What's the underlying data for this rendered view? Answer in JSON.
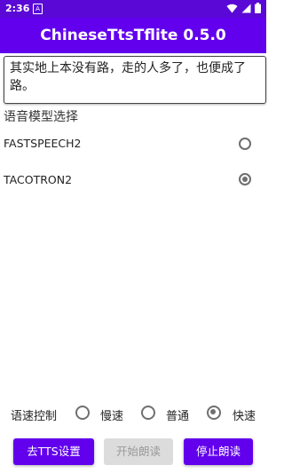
{
  "status_bar": {
    "time": "2:36",
    "icons": [
      "app-notification-icon",
      "wifi-icon",
      "signal-icon",
      "battery-icon"
    ]
  },
  "app_bar": {
    "title": "ChineseTtsTflite 0.5.0"
  },
  "text_input": {
    "value": "其实地上本没有路，走的人多了，也便成了路。"
  },
  "model_section": {
    "title": "语音模型选择",
    "options": [
      {
        "label": "FASTSPEECH2",
        "checked": false
      },
      {
        "label": "TACOTRON2",
        "checked": true
      }
    ]
  },
  "speed_control": {
    "label": "语速控制",
    "options": [
      {
        "label": "慢速",
        "checked": false
      },
      {
        "label": "普通",
        "checked": false
      },
      {
        "label": "快速",
        "checked": true
      }
    ]
  },
  "buttons": {
    "tts_settings": "去TTS设置",
    "start_reading": "开始朗读",
    "stop_reading": "停止朗读"
  },
  "colors": {
    "status_bar": "#5a08d6",
    "primary": "#6200ee",
    "disabled_button": "#dcdcdc"
  }
}
